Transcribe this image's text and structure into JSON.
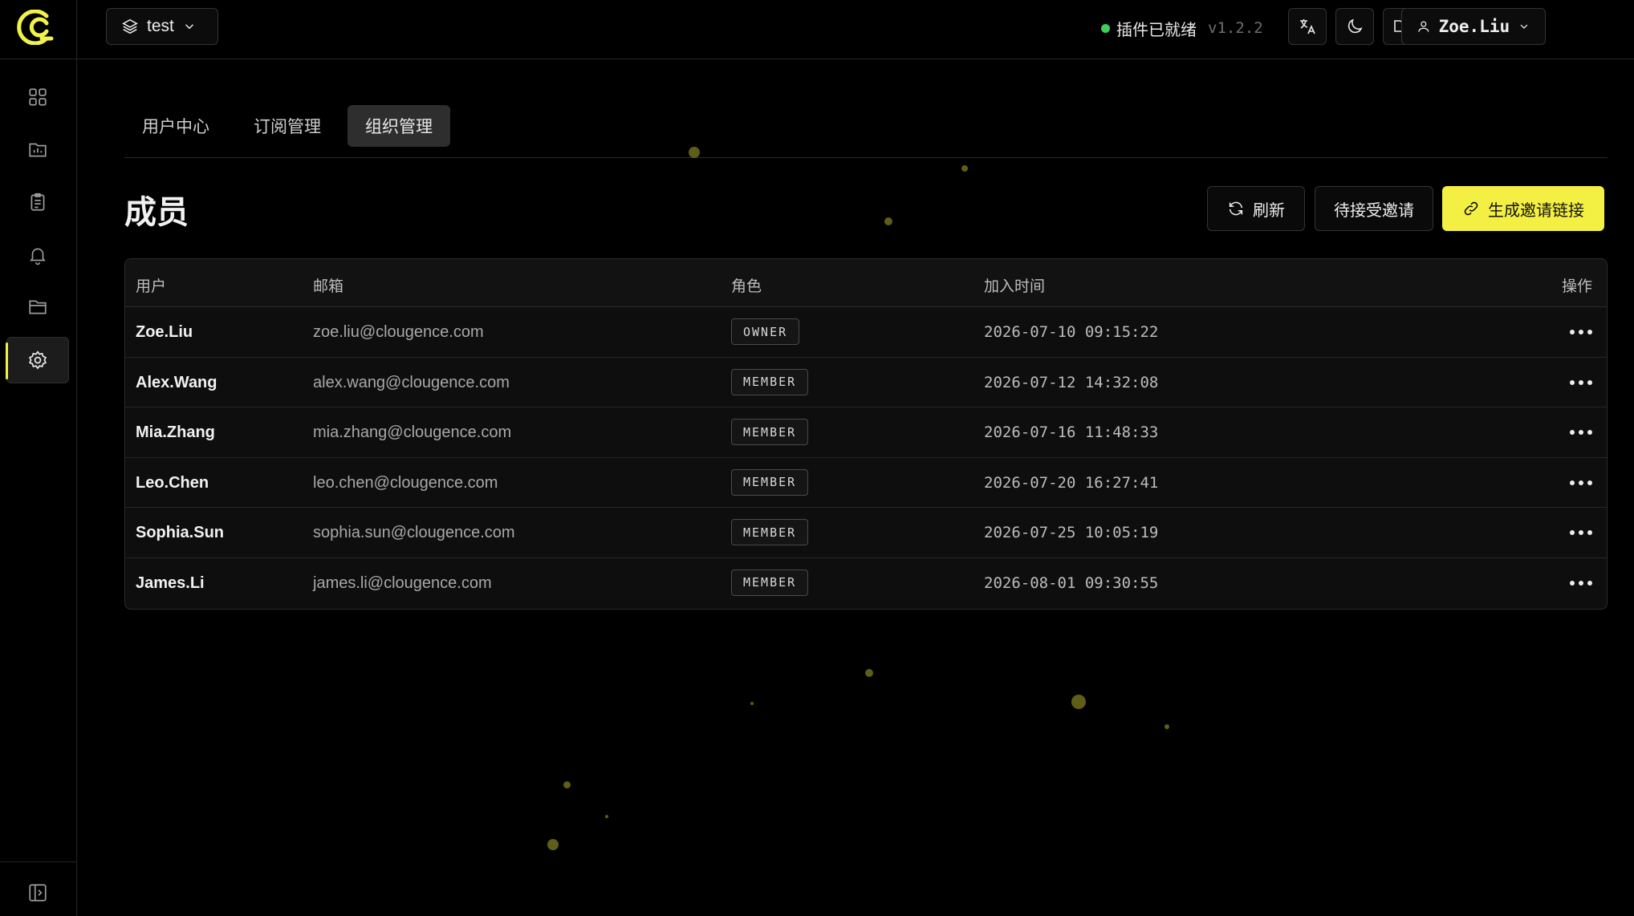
{
  "project": {
    "name": "test"
  },
  "status": {
    "text": "插件已就绪",
    "version": "v1.2.2",
    "color": "#3ecf5a"
  },
  "user": {
    "name": "Zoe.Liu"
  },
  "tabs": [
    {
      "label": "用户中心"
    },
    {
      "label": "订阅管理"
    },
    {
      "label": "组织管理"
    }
  ],
  "page": {
    "title": "成员"
  },
  "actions": {
    "refresh": "刷新",
    "pending": "待接受邀请",
    "generate": "生成邀请链接"
  },
  "table": {
    "headers": {
      "user": "用户",
      "email": "邮箱",
      "role": "角色",
      "joined": "加入时间",
      "ops": "操作"
    },
    "rows": [
      {
        "user": "Zoe.Liu",
        "email": "zoe.liu@clougence.com",
        "role": "OWNER",
        "joined": "2026-07-10 09:15:22"
      },
      {
        "user": "Alex.Wang",
        "email": "alex.wang@clougence.com",
        "role": "MEMBER",
        "joined": "2026-07-12 14:32:08"
      },
      {
        "user": "Mia.Zhang",
        "email": "mia.zhang@clougence.com",
        "role": "MEMBER",
        "joined": "2026-07-16 11:48:33"
      },
      {
        "user": "Leo.Chen",
        "email": "leo.chen@clougence.com",
        "role": "MEMBER",
        "joined": "2026-07-20 16:27:41"
      },
      {
        "user": "Sophia.Sun",
        "email": "sophia.sun@clougence.com",
        "role": "MEMBER",
        "joined": "2026-07-25 10:05:19"
      },
      {
        "user": "James.Li",
        "email": "james.li@clougence.com",
        "role": "MEMBER",
        "joined": "2026-08-01 09:30:55"
      }
    ]
  },
  "colors": {
    "accent": "#f4f043",
    "background": "#000000"
  },
  "icons": {
    "sidebar": [
      "dashboard-icon",
      "monitor-chart-icon",
      "clipboard-icon",
      "bell-icon",
      "folder-icon",
      "settings-icon"
    ],
    "top": [
      "translate-icon",
      "moon-icon",
      "book-icon",
      "headset-icon"
    ]
  }
}
